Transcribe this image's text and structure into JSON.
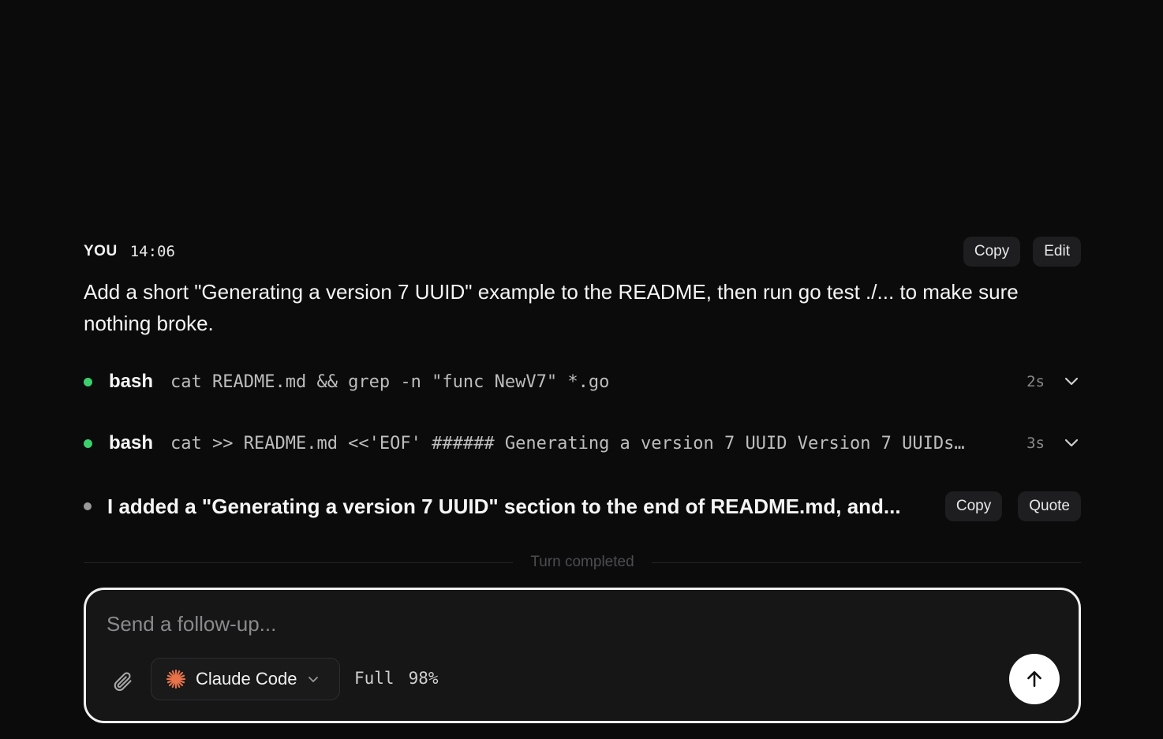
{
  "message": {
    "author": "YOU",
    "time": "14:06",
    "copy_label": "Copy",
    "edit_label": "Edit",
    "text": "Add a short \"Generating a version 7 UUID\" example to the README, then run go test ./... to make sure nothing broke."
  },
  "tools": [
    {
      "name": "bash",
      "command": "cat README.md && grep -n \"func NewV7\" *.go",
      "duration": "2s",
      "status_color": "#3ccf6e"
    },
    {
      "name": "bash",
      "command": "cat >> README.md <<'EOF' ###### Generating a version 7 UUID Version 7 UUIDs…",
      "duration": "3s",
      "status_color": "#3ccf6e"
    }
  ],
  "assistant": {
    "text": "I added a \"Generating a version 7 UUID\" section to the end of README.md, and...",
    "copy_label": "Copy",
    "quote_label": "Quote"
  },
  "divider": {
    "label": "Turn completed"
  },
  "composer": {
    "placeholder": "Send a follow-up...",
    "model": "Claude Code",
    "mode": "Full",
    "percent": "98%",
    "accent": "#e8734a"
  },
  "icons": {
    "attach": "paperclip-icon",
    "chevron": "chevron-down-icon",
    "model": "claude-spark-icon",
    "send": "arrow-up-icon"
  }
}
